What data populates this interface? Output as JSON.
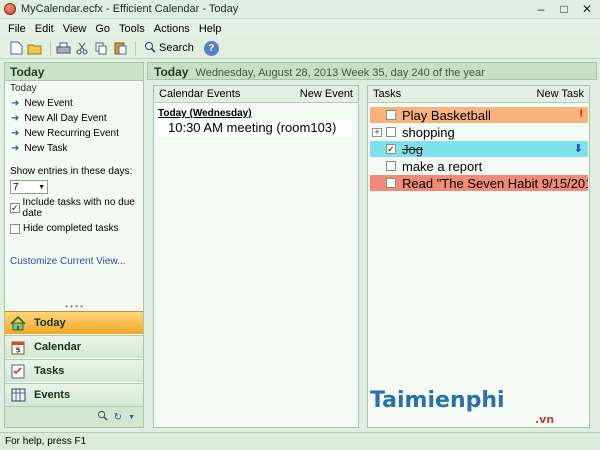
{
  "window": {
    "title": "MyCalendar.ecfx - Efficient Calendar - Today",
    "min": "–",
    "max": "□",
    "close": "✕"
  },
  "menu": [
    "File",
    "Edit",
    "View",
    "Go",
    "Tools",
    "Actions",
    "Help"
  ],
  "toolbar": {
    "search_label": "Search",
    "help_label": "?"
  },
  "left": {
    "header": "Today",
    "subheader": "Today",
    "actions": [
      "New Event",
      "New All Day Event",
      "New Recurring Event",
      "New Task"
    ],
    "entries_label": "Show entries in these days:",
    "entries_value": "7",
    "opt_no_due": "Include tasks with no due date",
    "opt_no_due_checked": true,
    "opt_hide_completed": "Hide completed tasks",
    "opt_hide_completed_checked": false,
    "customize": "Customize Current View...",
    "nav": [
      "Today",
      "Calendar",
      "Tasks",
      "Events"
    ]
  },
  "main": {
    "title": "Today",
    "info": "Wednesday, August 28, 2013   Week 35, day 240 of the year"
  },
  "events": {
    "header_left": "Calendar  Events",
    "header_right": "New Event",
    "day": "Today (Wednesday)",
    "items": [
      "10:30 AM meeting (room103)"
    ]
  },
  "tasks": {
    "header_left": "Tasks",
    "header_right": "New Task",
    "items": [
      {
        "text": "Play Basketball",
        "checked": false,
        "done": false,
        "color": "#f9b27a",
        "flag": "!",
        "flag_color": "#cc2200"
      },
      {
        "text": "shopping",
        "checked": false,
        "done": false,
        "color": "#f4faf4",
        "expander": "+"
      },
      {
        "text": "Jog",
        "checked": true,
        "done": true,
        "color": "#7fe2ea",
        "flag": "⬇",
        "flag_color": "#2c4fd0"
      },
      {
        "text": "make a report",
        "checked": false,
        "done": false,
        "color": "#f4faf4"
      },
      {
        "text": "Read \"The Seven Habit 9/15/201",
        "checked": false,
        "done": false,
        "color": "#f28a7a"
      }
    ]
  },
  "status": "For help, press F1",
  "watermark": {
    "brand": "Taimienphi",
    "tld": ".vn"
  },
  "colors": {
    "accent": "#f5a623",
    "panel_border": "#a9c4a9",
    "link": "#2b4ea0"
  }
}
